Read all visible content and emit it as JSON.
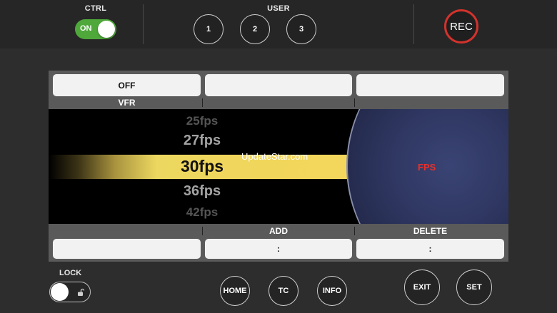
{
  "top": {
    "ctrl_label": "CTRL",
    "ctrl_toggle_text": "ON",
    "ctrl_on": true,
    "user_label": "USER",
    "user_buttons": [
      "1",
      "2",
      "3"
    ],
    "rec_label": "REC"
  },
  "panel": {
    "tabs": [
      "OFF",
      "",
      ""
    ],
    "headers": [
      "VFR",
      "",
      ""
    ],
    "fps_list": [
      "25fps",
      "27fps",
      "30fps",
      "36fps",
      "42fps"
    ],
    "selected_index": 2,
    "watermark": "UpdateStar.com",
    "dial_label": "FPS",
    "bottom_headers": [
      "",
      "ADD",
      "DELETE"
    ],
    "bottom_fields": [
      "",
      ":",
      ":"
    ]
  },
  "bottom": {
    "lock_label": "LOCK",
    "lock_on": false,
    "nav_buttons": [
      "HOME",
      "TC",
      "INFO"
    ],
    "exit_label": "EXIT",
    "set_label": "SET"
  },
  "colors": {
    "toggle_on": "#4ea83a",
    "rec_ring": "#d3322c",
    "highlight": "#f0d65c",
    "fps_label": "#e8302b"
  },
  "icons": [
    "lock-icon"
  ]
}
